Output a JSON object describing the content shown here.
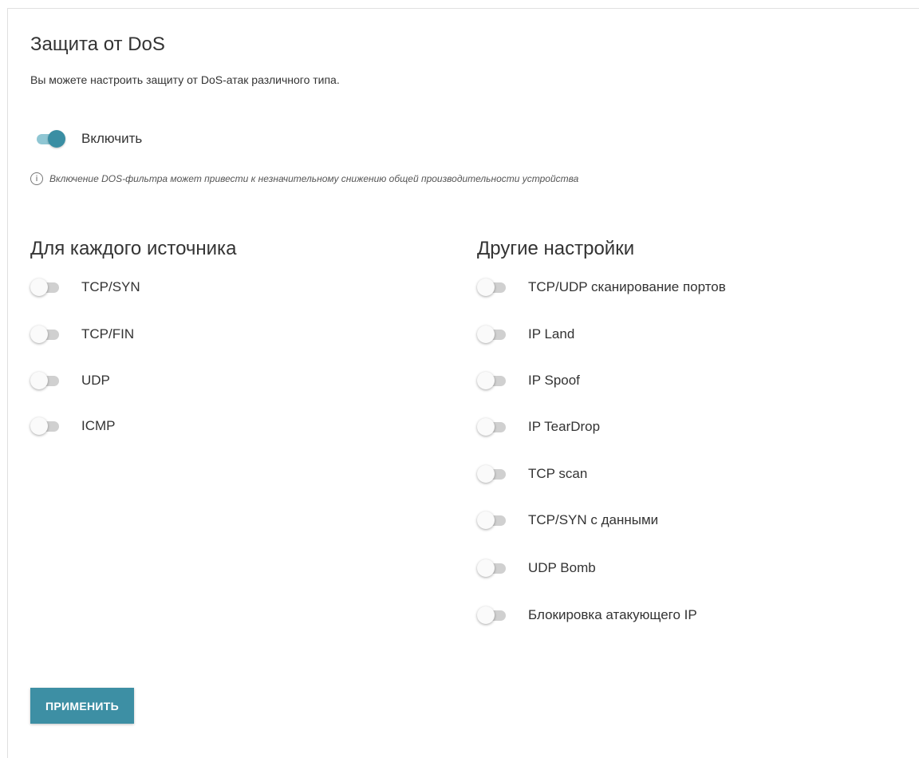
{
  "page": {
    "title": "Защита от DoS",
    "description": "Вы можете настроить защиту от DoS-атак различного типа."
  },
  "enable": {
    "label": "Включить",
    "on": true
  },
  "note": {
    "icon": "info-icon",
    "text": "Включение DOS-фильтра может привести к незначительному снижению общей производительности устройства"
  },
  "per_source": {
    "title": "Для каждого источника",
    "items": [
      {
        "label": "TCP/SYN",
        "on": false
      },
      {
        "label": "TCP/FIN",
        "on": false
      },
      {
        "label": "UDP",
        "on": false
      },
      {
        "label": "ICMP",
        "on": false
      }
    ]
  },
  "other": {
    "title": "Другие настройки",
    "items": [
      {
        "label": "TCP/UDP сканирование портов",
        "on": false
      },
      {
        "label": "IP Land",
        "on": false
      },
      {
        "label": "IP Spoof",
        "on": false
      },
      {
        "label": "IP TearDrop",
        "on": false
      },
      {
        "label": "TCP scan",
        "on": false
      },
      {
        "label": "TCP/SYN с данными",
        "on": false
      },
      {
        "label": "UDP Bomb",
        "on": false
      },
      {
        "label": "Блокировка атакующего IP",
        "on": false
      }
    ]
  },
  "apply_button": {
    "label": "ПРИМЕНИТЬ"
  },
  "colors": {
    "accent": "#3d8fa4",
    "toggle_on_track": "#8fc6d3",
    "toggle_off_track": "#d0d0d0"
  }
}
